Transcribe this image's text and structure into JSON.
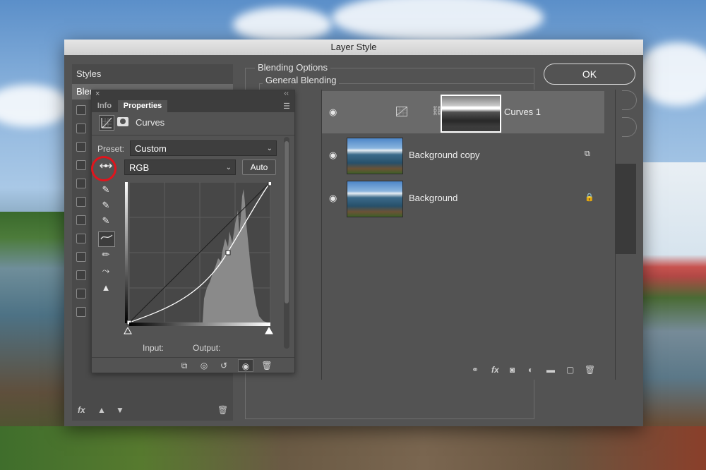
{
  "dialog": {
    "title": "Layer Style",
    "ok_label": "OK"
  },
  "styles_panel": {
    "header": "Styles",
    "selected_item": "Blending Options",
    "selected_item_visible": "Blen",
    "footer_fx": "fx"
  },
  "blending": {
    "group_label": "Blending Options",
    "subgroup_label": "General Blending"
  },
  "properties": {
    "tabs": [
      "Info",
      "Properties"
    ],
    "active_tab": "Properties",
    "panel_title": "Curves",
    "preset_label": "Preset:",
    "preset_value": "Custom",
    "channel_value": "RGB",
    "auto_label": "Auto",
    "input_label": "Input:",
    "output_label": "Output:",
    "highlighted_tool": "targeted-adjustment-tool"
  },
  "layers": [
    {
      "name": "Curves 1",
      "type": "adjustment",
      "selected": true,
      "visible": true
    },
    {
      "name": "Background copy",
      "type": "smart-object",
      "selected": false,
      "visible": true
    },
    {
      "name": "Background",
      "type": "locked",
      "selected": false,
      "visible": true
    }
  ],
  "colors": {
    "panel_bg": "#535353",
    "highlight_ring": "#e0141c",
    "selected_row": "#6a6a6a"
  }
}
